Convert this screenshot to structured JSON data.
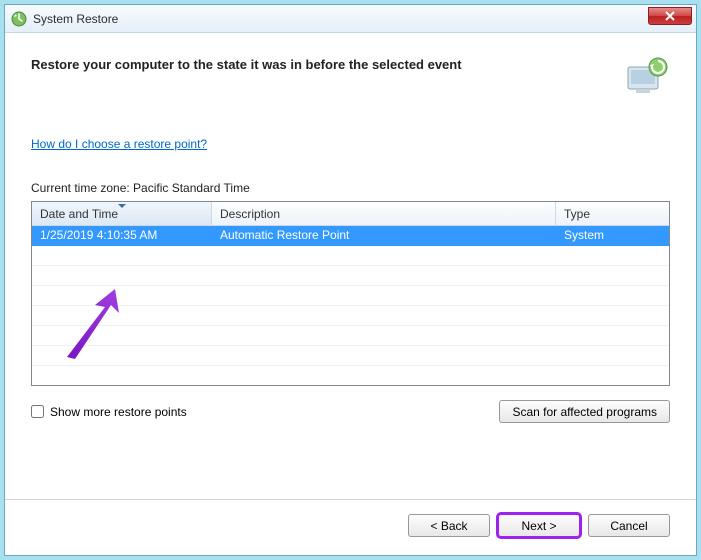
{
  "window": {
    "title": "System Restore"
  },
  "heading": "Restore your computer to the state it was in before the selected event",
  "help_link": "How do I choose a restore point?",
  "timezone_label": "Current time zone: Pacific Standard Time",
  "columns": {
    "date": "Date and Time",
    "desc": "Description",
    "type": "Type"
  },
  "rows": [
    {
      "date": "1/25/2019 4:10:35 AM",
      "desc": "Automatic Restore Point",
      "type": "System"
    }
  ],
  "checkbox_label": "Show more restore points",
  "scan_button": "Scan for affected programs",
  "footer": {
    "back": "< Back",
    "next": "Next >",
    "cancel": "Cancel"
  }
}
